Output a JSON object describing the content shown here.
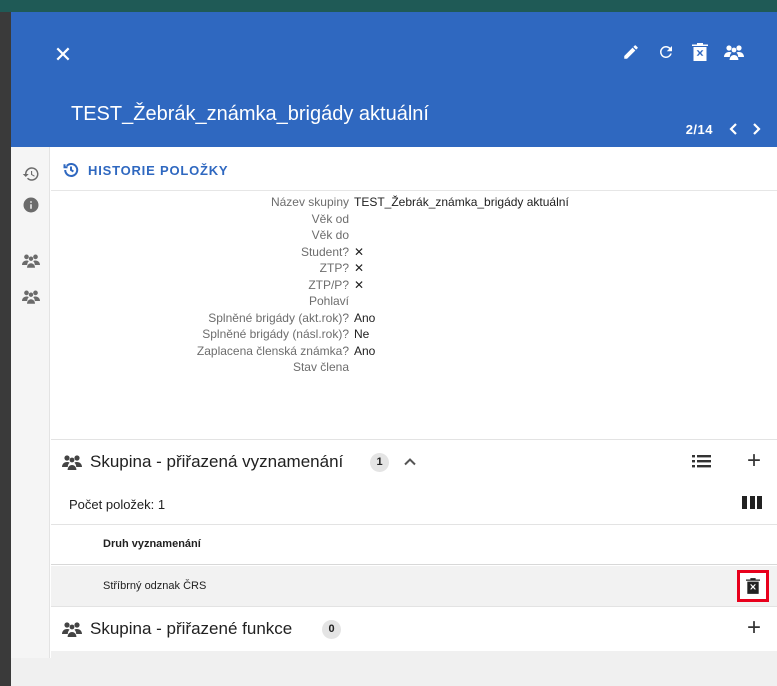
{
  "header": {
    "title": "TEST_Žebrák_známka_brigády aktuální",
    "close_glyph": "✕",
    "pager": {
      "current": "2",
      "total": "14",
      "text": "2/14"
    },
    "toolbar": [
      "edit-icon",
      "refresh-icon",
      "delete-icon",
      "group-icon"
    ]
  },
  "rail": {
    "items": [
      "history-icon",
      "info-icon",
      "group-icon",
      "group-icon"
    ]
  },
  "history": {
    "heading": "HISTORIE POLOŽKY"
  },
  "fields": [
    {
      "label": "Název skupiny",
      "value": "TEST_Žebrák_známka_brigády aktuální"
    },
    {
      "label": "Věk od",
      "value": ""
    },
    {
      "label": "Věk do",
      "value": ""
    },
    {
      "label": "Student?",
      "value": "✕"
    },
    {
      "label": "ZTP?",
      "value": "✕"
    },
    {
      "label": "ZTP/P?",
      "value": "✕"
    },
    {
      "label": "Pohlaví",
      "value": ""
    },
    {
      "label": "Splněné brigády (akt.rok)?",
      "value": "Ano"
    },
    {
      "label": "Splněné brigády (násl.rok)?",
      "value": "Ne"
    },
    {
      "label": "Zaplacena členská známka?",
      "value": "Ano"
    },
    {
      "label": "Stav člena",
      "value": ""
    }
  ],
  "sections": [
    {
      "title": "Skupina - přiřazená vyznamenání",
      "badge": "1",
      "count_label": "Počet položek: 1",
      "column_header": "Druh vyznamenání",
      "rows": [
        "Stříbrný odznak ČRS"
      ]
    },
    {
      "title": "Skupina - přiřazené funkce",
      "badge": "0"
    }
  ],
  "plus_glyph": "+",
  "colors": {
    "header_bg": "#2f68c0",
    "accent": "#2f68c0",
    "highlight": "#e8001c"
  }
}
